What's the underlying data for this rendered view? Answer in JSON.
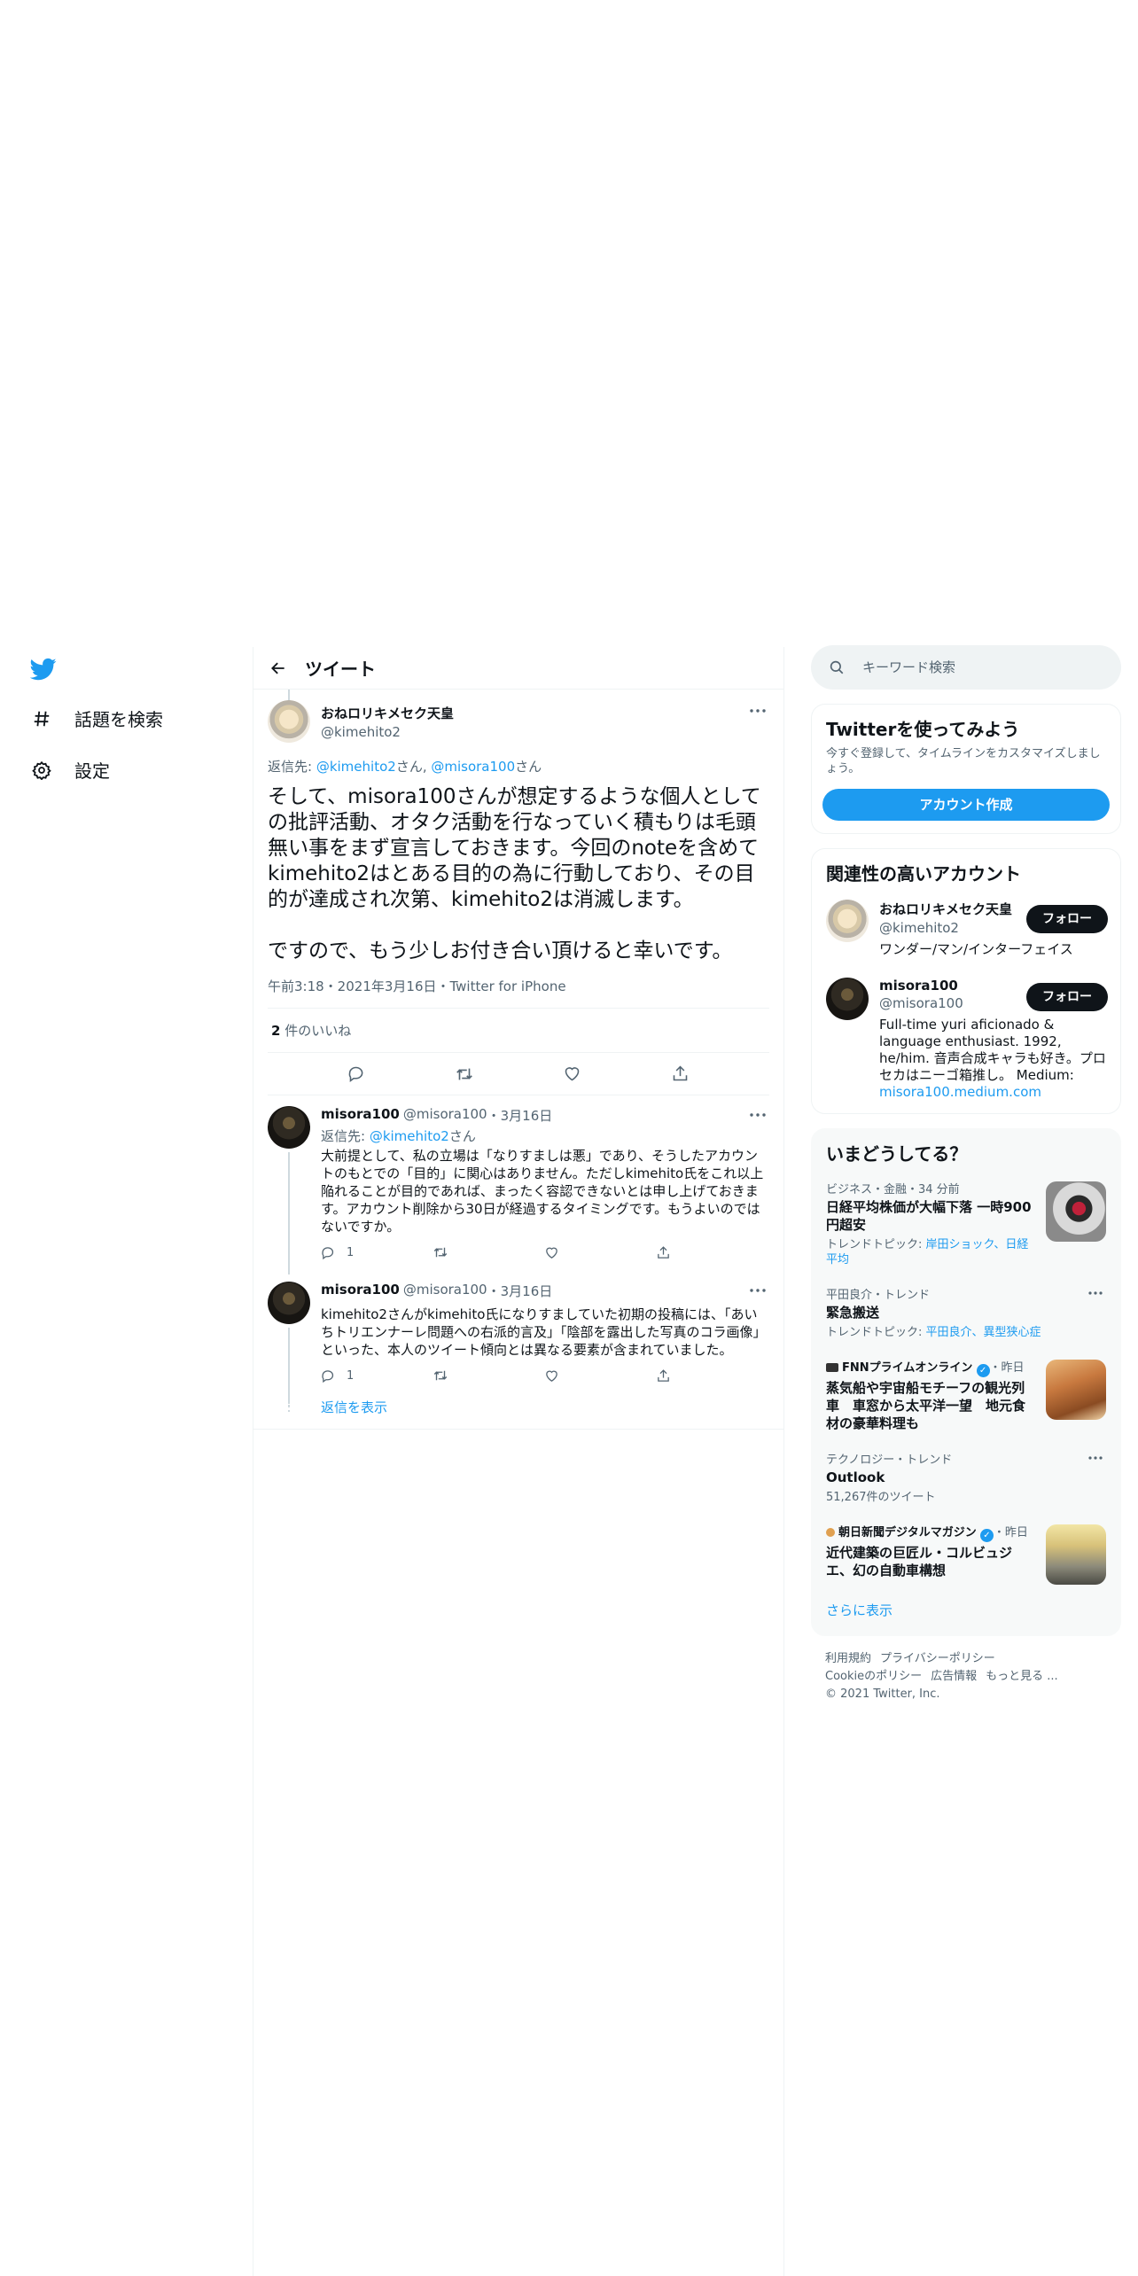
{
  "nav": {
    "items": [
      {
        "label": "話題を検索",
        "icon": "hashtag-icon"
      },
      {
        "label": "設定",
        "icon": "gear-icon"
      }
    ]
  },
  "header": {
    "title": "ツイート"
  },
  "tweet": {
    "name": "おねロリキメセク天皇",
    "handle": "@kimehito2",
    "reply_prefix": "返信先: ",
    "reply_to_1": "@kimehito2",
    "reply_suffix_1": "さん, ",
    "reply_to_2": "@misora100",
    "reply_suffix_2": "さん",
    "text": "そして、misora100さんが想定するような個人としての批評活動、オタク活動を行なっていく積もりは毛頭無い事をまず宣言しておきます。今回のnoteを含めてkimehito2はとある目的の為に行動しており、その目的が達成され次第、kimehito2は消滅します。\n\nですので、もう少しお付き合い頂けると幸いです。",
    "meta": "午前3:18・2021年3月16日・Twitter for iPhone",
    "likes_count": "2",
    "likes_label": " 件のいいね"
  },
  "replies": [
    {
      "name": "misora100",
      "handle": "@misora100",
      "date": "・3月16日",
      "reply_prefix": "返信先: ",
      "reply_to": "@kimehito2",
      "reply_suffix": "さん",
      "text": "大前提として、私の立場は「なりすましは悪」であり、そうしたアカウントのもとでの「目的」に関心はありません。ただしkimehito氏をこれ以上陥れることが目的であれば、まったく容認できないとは申し上げておきます。アカウント削除から30日が経過するタイミングです。もうよいのではないですか。",
      "reply_count": "1"
    },
    {
      "name": "misora100",
      "handle": "@misora100",
      "date": "・3月16日",
      "text": "kimehito2さんがkimehito氏になりすましていた初期の投稿には、「あいちトリエンナーレ問題への右派的言及」「陰部を露出した写真のコラ画像」といった、本人のツイート傾向とは異なる要素が含まれていました。",
      "reply_count": "1"
    }
  ],
  "show_replies": "返信を表示",
  "search": {
    "placeholder": "キーワード検索"
  },
  "signup": {
    "title": "Twitterを使ってみよう",
    "sub": "今すぐ登録して、タイムラインをカスタマイズしましょう。",
    "button": "アカウント作成"
  },
  "related": {
    "title": "関連性の高いアカウント",
    "accounts": [
      {
        "name": "おねロリキメセク天皇",
        "handle": "@kimehito2",
        "bio": "ワンダー/マン/インターフェイス",
        "follow": "フォロー"
      },
      {
        "name": "misora100",
        "handle": "@misora100",
        "bio": "Full-time yuri aficionado & language enthusiast. 1992, he/him. 音声合成キャラも好き。プロセカはニーゴ箱推し。 Medium: ",
        "link": "misora100.medium.com",
        "follow": "フォロー"
      }
    ]
  },
  "trends": {
    "title": "いまどうしてる？",
    "items": [
      {
        "ctx": "ビジネス・金融・34 分前",
        "title": "日経平均株価が大幅下落 一時900円超安",
        "sub_prefix": "トレンドトピック: ",
        "sub_links": "岸田ショック、日経平均"
      },
      {
        "ctx": "平田良介・トレンド",
        "title": "緊急搬送",
        "sub_prefix": "トレンドトピック: ",
        "sub_links": "平田良介、異型狭心症"
      },
      {
        "ctx_source": "FNNプライムオンライン",
        "ctx_time": "・昨日",
        "title": "蒸気船や宇宙船モチーフの観光列車　車窓から太平洋一望　地元食材の豪華料理も"
      },
      {
        "ctx": "テクノロジー・トレンド",
        "title": "Outlook",
        "sub": "51,267件のツイート"
      },
      {
        "ctx_source": "朝日新聞デジタルマガジン",
        "ctx_time": "・昨日",
        "title": "近代建築の巨匠ル・コルビュジエ、幻の自動車構想"
      }
    ],
    "show_more": "さらに表示"
  },
  "footer": {
    "links": [
      "利用規約",
      "プライバシーポリシー",
      "Cookieのポリシー",
      "広告情報",
      "もっと見る ..."
    ],
    "copyright": "© 2021 Twitter, Inc."
  },
  "colors": {
    "accent": "#1d9bf0",
    "text": "#0f1419",
    "muted": "#536471"
  }
}
